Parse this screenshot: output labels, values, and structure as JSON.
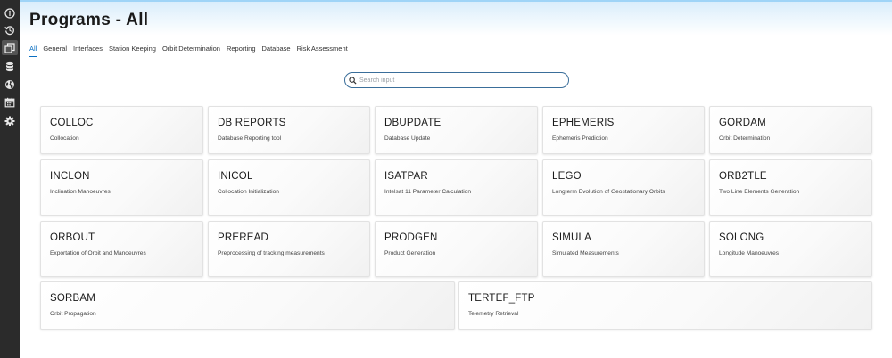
{
  "page": {
    "title": "Programs - All"
  },
  "sidebar": {
    "items": [
      {
        "icon": "info-icon"
      },
      {
        "icon": "history-icon"
      },
      {
        "icon": "windows-icon"
      },
      {
        "icon": "database-icon"
      },
      {
        "icon": "globe-icon"
      },
      {
        "icon": "calendar-icon"
      },
      {
        "icon": "gear-icon"
      }
    ],
    "active_index": 2
  },
  "tabs": [
    {
      "label": "All",
      "active": true
    },
    {
      "label": "General"
    },
    {
      "label": "Interfaces"
    },
    {
      "label": "Station Keeping"
    },
    {
      "label": "Orbit Determination"
    },
    {
      "label": "Reporting"
    },
    {
      "label": "Database"
    },
    {
      "label": "Risk Assessment"
    }
  ],
  "search": {
    "placeholder": "Search input",
    "value": ""
  },
  "programs": [
    {
      "name": "COLLOC",
      "description": "Collocation"
    },
    {
      "name": "DB REPORTS",
      "description": "Database Reporting tool"
    },
    {
      "name": "DBUPDATE",
      "description": "Database Update"
    },
    {
      "name": "EPHEMERIS",
      "description": "Ephemeris Prediction"
    },
    {
      "name": "GORDAM",
      "description": "Orbit Determination"
    },
    {
      "name": "INCLON",
      "description": "Inclination Manoeuvres"
    },
    {
      "name": "INICOL",
      "description": "Collocation Initialization"
    },
    {
      "name": "ISATPAR",
      "description": "Intelsat 11 Parameter Calculation"
    },
    {
      "name": "LEGO",
      "description": "Longterm Evolution of Geostationary Orbits"
    },
    {
      "name": "ORB2TLE",
      "description": "Two Line Elements Generation"
    },
    {
      "name": "ORBOUT",
      "description": "Exportation of Orbit and Manoeuvres"
    },
    {
      "name": "PREREAD",
      "description": "Preprocessing of tracking measurements"
    },
    {
      "name": "PRODGEN",
      "description": "Product Generation"
    },
    {
      "name": "SIMULA",
      "description": "Simulated Measurements"
    },
    {
      "name": "SOLONG",
      "description": "Longitude Manoeuvres"
    },
    {
      "name": "SORBAM",
      "description": "Orbit Propagation"
    },
    {
      "name": "TERTEF_FTP",
      "description": "Telemetry Retrieval"
    }
  ],
  "colors": {
    "accent": "#0a6fc2",
    "sidebar": "#2b2b2b",
    "search_border": "#3a6e9a"
  }
}
